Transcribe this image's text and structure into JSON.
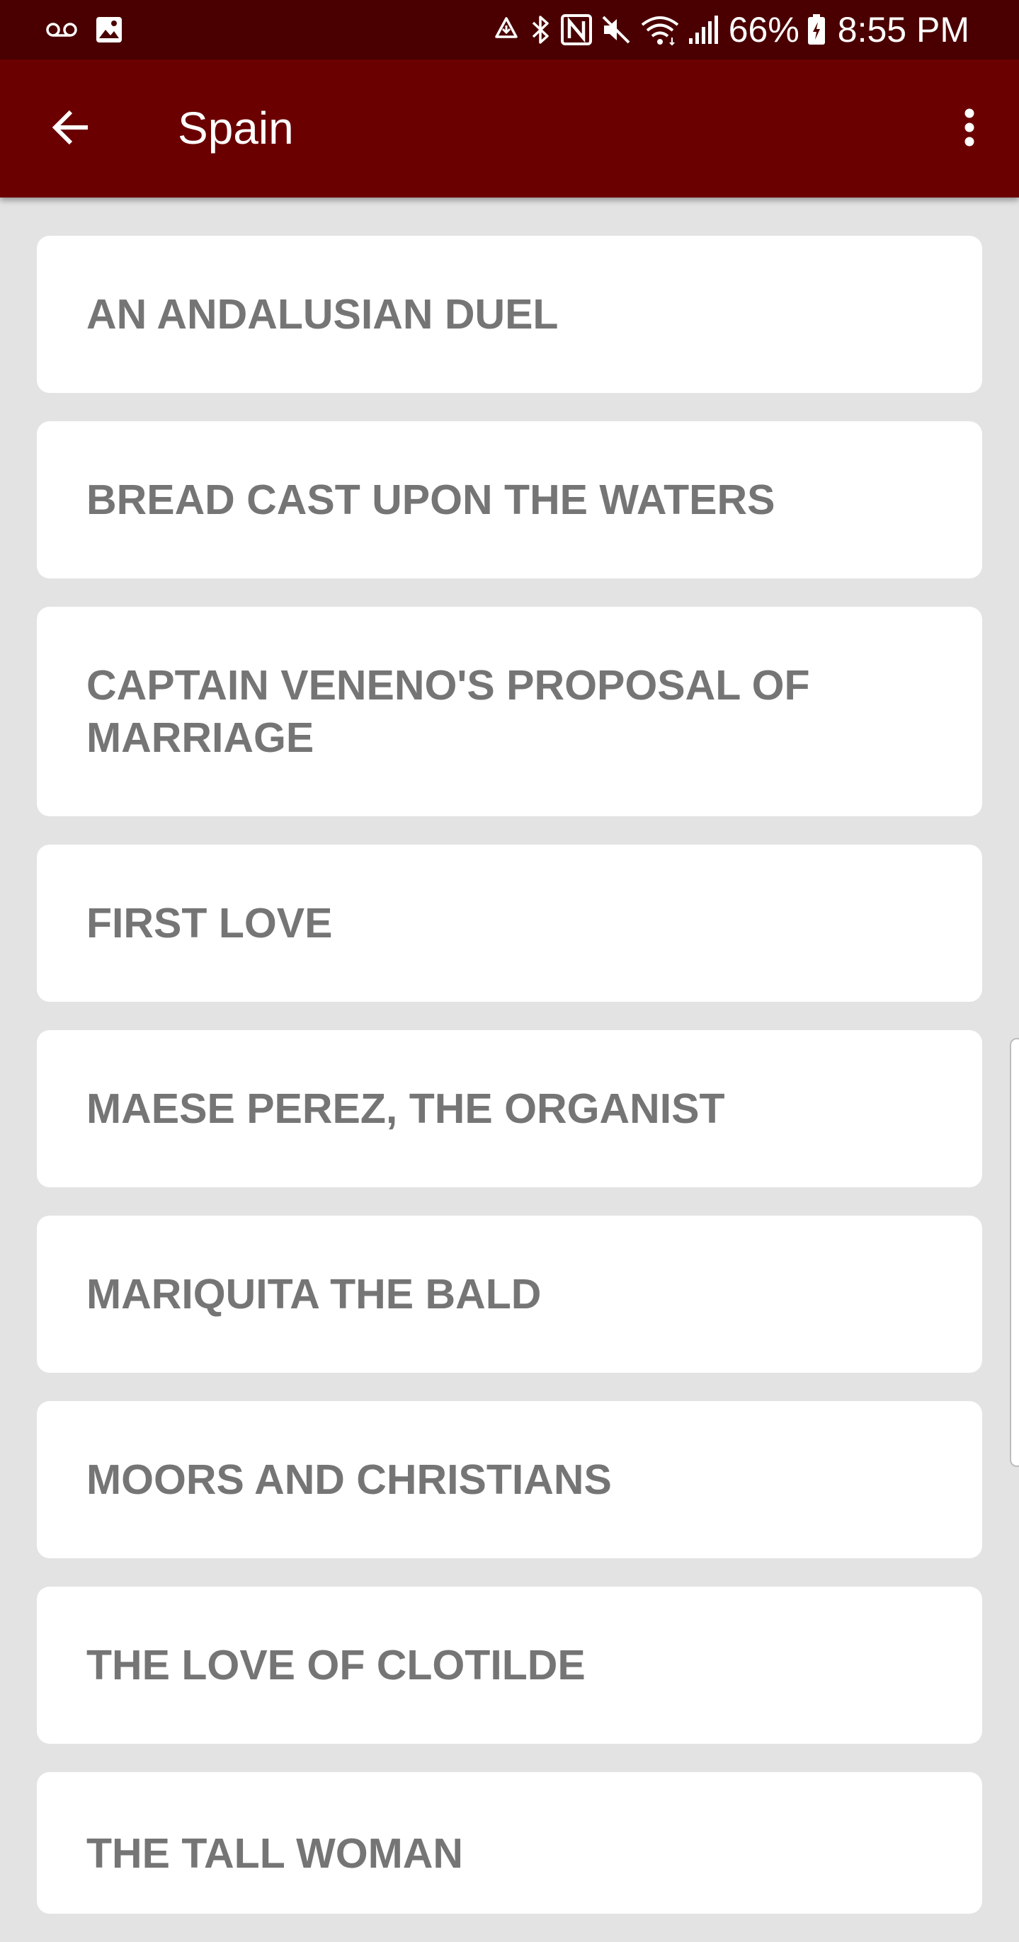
{
  "status_bar": {
    "icons_left": [
      "voicemail-icon",
      "image-icon"
    ],
    "icons_right": [
      "sync-icon",
      "bluetooth-icon",
      "nfc-icon",
      "mute-icon",
      "wifi-icon",
      "signal-icon"
    ],
    "battery_percent": "66%",
    "time": "8:55 PM"
  },
  "app_bar": {
    "title": "Spain",
    "back_icon": "arrow-back-icon",
    "menu_icon": "more-vert-icon"
  },
  "colors": {
    "status_bar": "#4a0000",
    "app_bar": "#6b0000",
    "background": "#e3e3e3",
    "card": "#ffffff",
    "card_text": "#757575"
  },
  "stories": [
    "AN ANDALUSIAN DUEL",
    "BREAD CAST UPON THE WATERS",
    "CAPTAIN VENENO'S PROPOSAL OF MARRIAGE",
    "FIRST LOVE",
    "MAESE PEREZ, THE ORGANIST",
    "MARIQUITA THE BALD",
    "MOORS AND CHRISTIANS",
    "THE LOVE OF CLOTILDE",
    "THE TALL WOMAN"
  ]
}
